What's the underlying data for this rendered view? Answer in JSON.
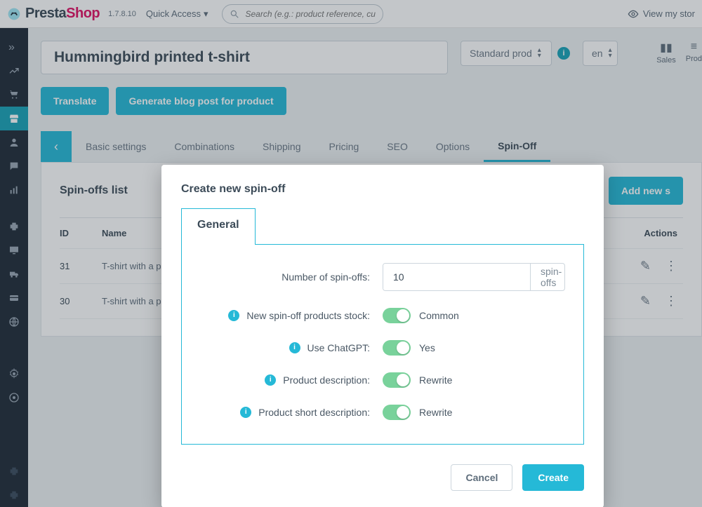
{
  "topbar": {
    "brand_a": "Presta",
    "brand_b": "Shop",
    "version": "1.7.8.10",
    "quick_access": "Quick Access",
    "search_placeholder": "Search (e.g.: product reference, custon",
    "view_store": "View my stor"
  },
  "leftnav": {
    "items": [
      "expand",
      "trend",
      "cart",
      "catalog",
      "person",
      "chat",
      "chart",
      "spacer",
      "puzzle",
      "monitor",
      "truck",
      "card",
      "globe",
      "spacer",
      "gear",
      "gear2",
      "spacer",
      "puzzle-faded-1",
      "puzzle-faded-2"
    ]
  },
  "product": {
    "name_value": "Hummingbird printed t-shirt",
    "type_label": "Standard prod",
    "lang_label": "en",
    "translate_btn": "Translate",
    "blog_btn": "Generate blog post for product",
    "stats": {
      "sales": "Sales",
      "products": "Prod"
    }
  },
  "tabs": {
    "items": [
      "Basic settings",
      "Combinations",
      "Shipping",
      "Pricing",
      "SEO",
      "Options",
      "Spin-Off"
    ],
    "active_index": 6
  },
  "card": {
    "title": "Spin-offs list",
    "add_btn": "Add new s",
    "columns": {
      "id": "ID",
      "name": "Name",
      "actions": "Actions"
    },
    "rows": [
      {
        "id": "31",
        "name": "T-shirt with a print o"
      },
      {
        "id": "30",
        "name": "T-shirt with a print o"
      }
    ]
  },
  "modal": {
    "title": "Create new spin-off",
    "tab_label": "General",
    "fields": {
      "num_label": "Number of spin-offs:",
      "num_value": "10",
      "num_suffix": "spin-offs",
      "stock_label": "New spin-off products stock:",
      "stock_value": "Common",
      "chatgpt_label": "Use ChatGPT:",
      "chatgpt_value": "Yes",
      "desc_label": "Product description:",
      "desc_value": "Rewrite",
      "sdesc_label": "Product short description:",
      "sdesc_value": "Rewrite"
    },
    "footer": {
      "cancel": "Cancel",
      "create": "Create"
    }
  }
}
